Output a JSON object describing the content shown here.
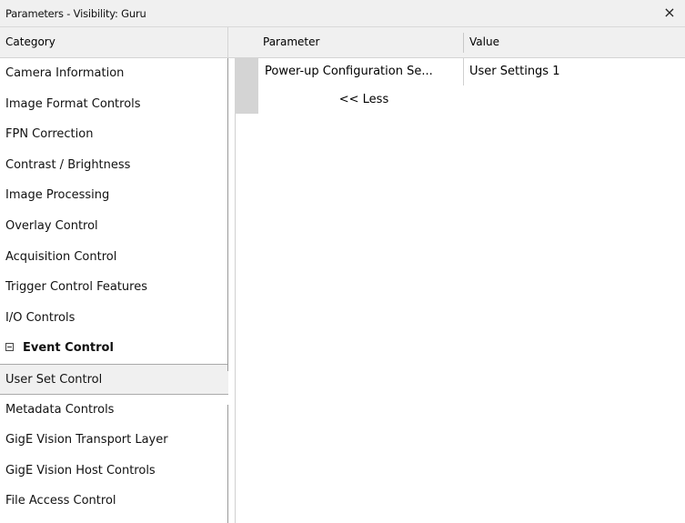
{
  "window": {
    "title": "Parameters - Visibility: Guru",
    "close_glyph": "×"
  },
  "columns": {
    "category": "Category",
    "parameter": "Parameter",
    "value": "Value"
  },
  "categories": [
    {
      "label": "Camera Information"
    },
    {
      "label": "Image Format Controls"
    },
    {
      "label": "FPN Correction"
    },
    {
      "label": "Contrast / Brightness"
    },
    {
      "label": "Image Processing"
    },
    {
      "label": "Overlay Control"
    },
    {
      "label": "Acquisition Control"
    },
    {
      "label": "Trigger Control Features"
    },
    {
      "label": "I/O Controls"
    },
    {
      "label": "Event Control",
      "expanded": true
    },
    {
      "label": "User Set Control",
      "selected": true
    },
    {
      "label": "Metadata Controls"
    },
    {
      "label": "GigE Vision Transport Layer"
    },
    {
      "label": "GigE Vision Host Controls"
    },
    {
      "label": "File Access Control"
    }
  ],
  "parameters": [
    {
      "name": "Power-up Configuration Se...",
      "value": "User Settings 1"
    }
  ],
  "less_link": "<< Less",
  "colors": {
    "header_bg": "#f0f0f0",
    "selected_bg": "#f0f0f0",
    "gutter": "#d4d4d4"
  }
}
